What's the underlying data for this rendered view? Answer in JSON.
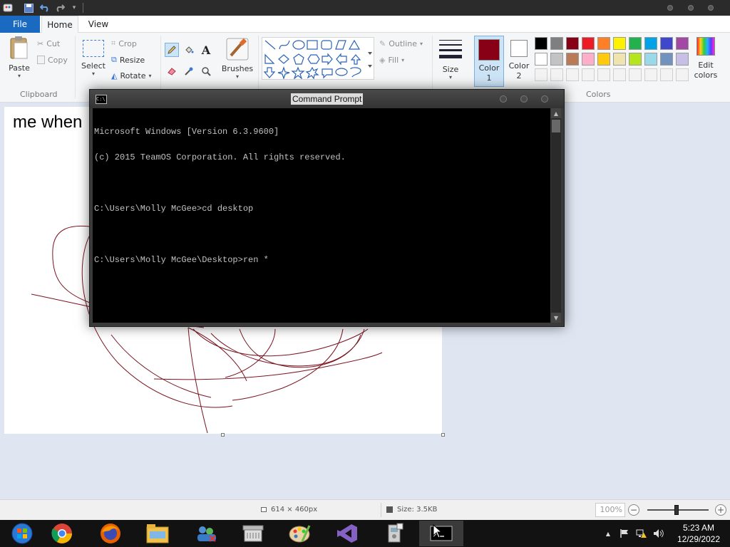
{
  "ribbon": {
    "tabs": {
      "file": "File",
      "home": "Home",
      "view": "View"
    },
    "clipboard": {
      "paste": "Paste",
      "cut": "Cut",
      "copy": "Copy",
      "group": "Clipboard"
    },
    "image": {
      "select": "Select",
      "crop": "Crop",
      "resize": "Resize",
      "rotate": "Rotate"
    },
    "brushes": "Brushes",
    "shapes": {
      "outline": "Outline",
      "fill": "Fill"
    },
    "size": "Size",
    "colors": {
      "color1": "Color",
      "color1_num": "1",
      "color2": "Color",
      "color2_num": "2",
      "edit": "Edit",
      "edit2": "colors",
      "group": "Colors",
      "color1_value": "#880015",
      "color2_value": "#ffffff",
      "palette_row1": [
        "#000000",
        "#7f7f7f",
        "#880015",
        "#ed1c24",
        "#ff7f27",
        "#fff200",
        "#22b14c",
        "#00a2e8",
        "#3f48cc",
        "#a349a4"
      ],
      "palette_row2": [
        "#ffffff",
        "#c3c3c3",
        "#b97a57",
        "#ffaec9",
        "#ffc90e",
        "#efe4b0",
        "#b5e61d",
        "#99d9ea",
        "#7092be",
        "#c8bfe7"
      ]
    }
  },
  "canvas": {
    "text": "me when"
  },
  "cmd": {
    "title": "Command Prompt",
    "lines": [
      "Microsoft Windows [Version 6.3.9600]",
      "(c) 2015 TeamOS Corporation. All rights reserved.",
      "",
      "C:\\Users\\Molly McGee>cd desktop",
      "",
      "C:\\Users\\Molly McGee\\Desktop>ren *"
    ]
  },
  "statusbar": {
    "dimensions": "614 × 460px",
    "size": "Size: 3.5KB",
    "zoom": "100%"
  },
  "taskbar": {
    "time": "5:23 AM",
    "date": "12/29/2022"
  }
}
